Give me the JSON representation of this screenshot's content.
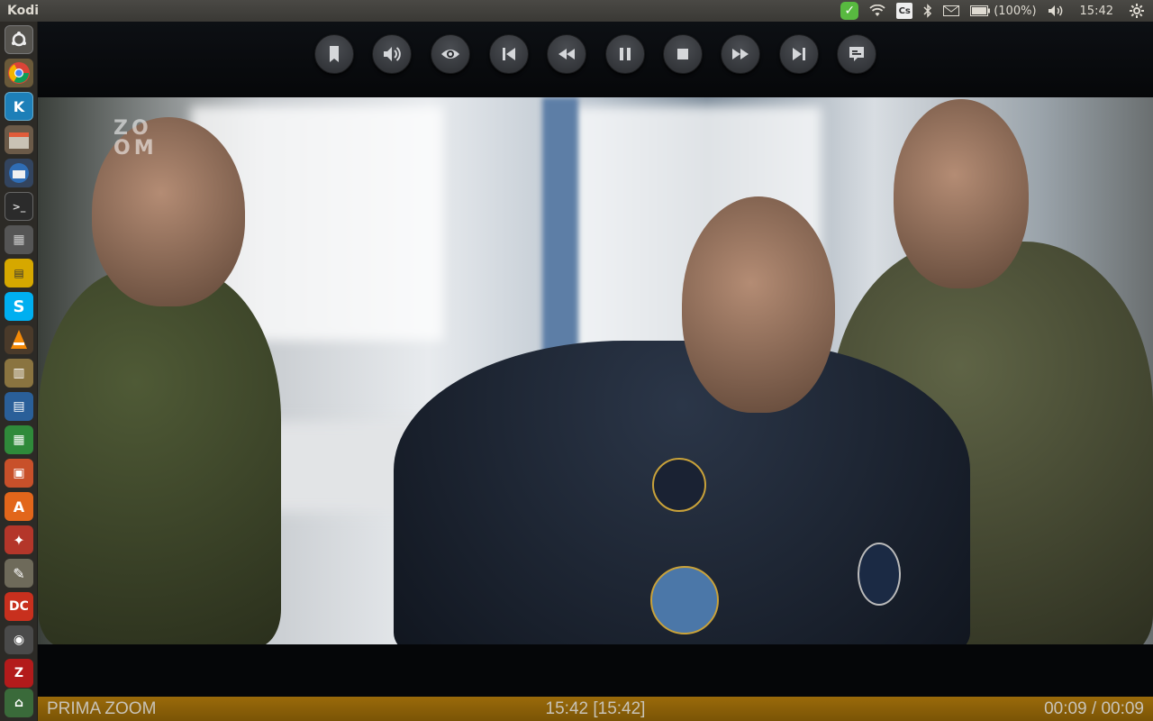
{
  "panel": {
    "app_title": "Kodi",
    "battery": "(100%)",
    "clock": "15:42",
    "cs_label": "Cs"
  },
  "launcher": {
    "items": [
      "dash",
      "chrome",
      "kodi",
      "files",
      "thunderbird",
      "terminal",
      "calculator",
      "filezilla-ftp",
      "skype",
      "vlc",
      "archive-manager",
      "writer",
      "calc",
      "impress",
      "software-center",
      "system-settings",
      "cleaner",
      "doublecmd",
      "webcam",
      "filezilla",
      "usb-drive"
    ]
  },
  "osd": {
    "buttons": [
      "bookmark-icon",
      "volume-icon",
      "eye-icon",
      "skip-previous-icon",
      "rewind-icon",
      "pause-icon",
      "stop-icon",
      "fast-forward-icon",
      "skip-next-icon",
      "subtitles-icon"
    ]
  },
  "video": {
    "watermark_line1": "ZO",
    "watermark_line2": "OM"
  },
  "info_bar": {
    "channel": "PRIMA ZOOM",
    "time": "15:42 [15:42]",
    "progress": "00:09 / 00:09"
  }
}
